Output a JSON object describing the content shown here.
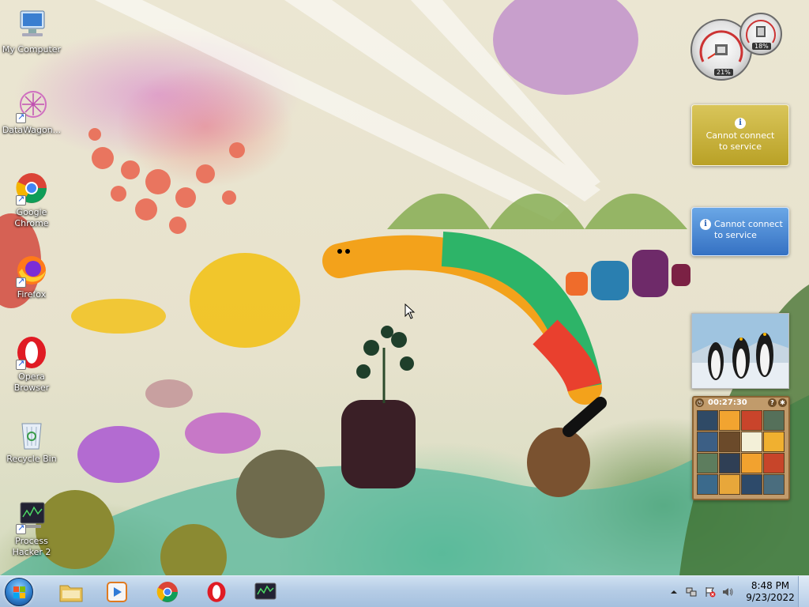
{
  "desktop": {
    "icons": [
      {
        "label": "My Computer"
      },
      {
        "label": "DataWagon..."
      },
      {
        "label": "Google Chrome"
      },
      {
        "label": "Firefox"
      },
      {
        "label": "Opera Browser"
      },
      {
        "label": "Recycle Bin"
      },
      {
        "label": "Process Hacker 2"
      }
    ]
  },
  "gadgets": {
    "cpu_meter": {
      "cpu_percent": "21%",
      "memory_percent": "18%"
    },
    "weather_1": {
      "message": "Cannot connect to service",
      "icon": "info-icon"
    },
    "weather_2": {
      "message": "Cannot connect to service",
      "icon": "info-icon"
    },
    "slideshow": {
      "subject": "penguins"
    },
    "puzzle": {
      "timer": "00:27:30",
      "help": "?"
    }
  },
  "taskbar": {
    "start": "start-orb",
    "pinned": [
      "Windows Explorer",
      "Windows Media Player",
      "Google Chrome",
      "Opera",
      "Process Hacker"
    ],
    "tray": {
      "time": "8:48 PM",
      "date": "9/23/2022"
    }
  },
  "colors": {
    "taskbar": "#b6cde6",
    "weather_gold": "#c9b23a",
    "weather_blue": "#4a86d0",
    "puzzle_frame": "#c19b6b"
  }
}
